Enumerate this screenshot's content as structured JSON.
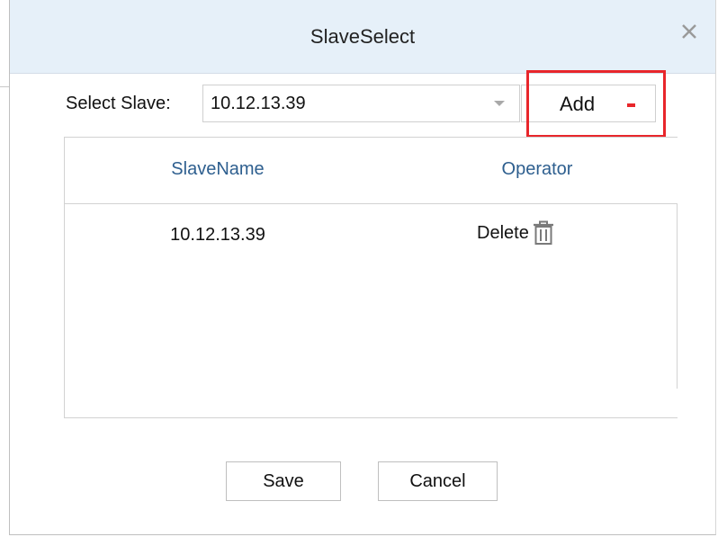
{
  "dialog": {
    "title": "SlaveSelect",
    "close_icon": "close-icon"
  },
  "select": {
    "label": "Select Slave:",
    "value": "10.12.13.39",
    "arrow_icon": "dropdown-arrow-icon"
  },
  "add_button": {
    "label": "Add",
    "highlight_color": "#e8262b"
  },
  "table": {
    "columns": [
      "SlaveName",
      "Operator"
    ],
    "rows": [
      {
        "name": "10.12.13.39",
        "operation": "Delete",
        "icon": "trash-icon"
      }
    ]
  },
  "footer": {
    "save_label": "Save",
    "cancel_label": "Cancel"
  },
  "colors": {
    "title_bar": "#e6f0f9",
    "header_text": "#2e5f8f"
  }
}
